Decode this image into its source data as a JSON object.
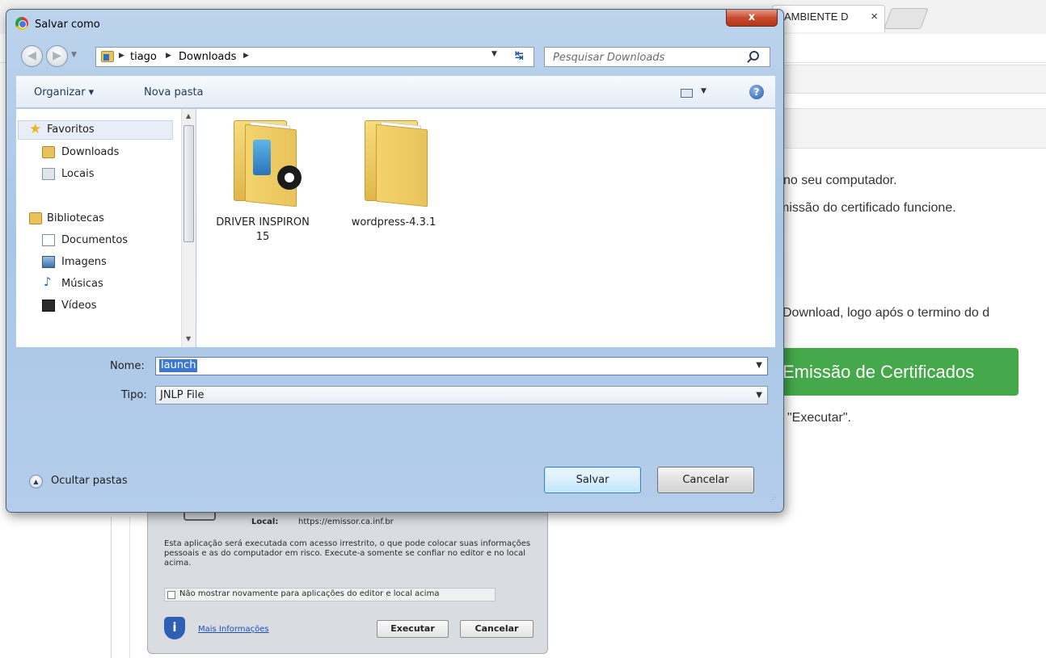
{
  "browser": {
    "tab_title": "AMBIENTE D",
    "tab_close": "×"
  },
  "page": {
    "line1": "no seu computador.",
    "line2": "missão do certificado funcione.",
    "line3": "Download, logo após o termino do d",
    "emission_button": "Emissão de Certificados",
    "line4": "\"Executar\".",
    "accent_color": "#45a84a"
  },
  "java_dialog": {
    "local_label": "Local:",
    "local_value": "https://emissor.ca.inf.br",
    "warning": "Esta aplicação será executada com acesso irrestrito, o que pode colocar suas informações pessoais e as do computador em risco. Execute-a somente se confiar no editor e no local acima.",
    "checkbox_label": "Não mostrar novamente para aplicações do editor e local acima",
    "more_info": "Mais Informações",
    "run_button": "Executar",
    "cancel_button": "Cancelar",
    "info_icon": "i"
  },
  "save_dialog": {
    "title": "Salvar como",
    "close_glyph": "x",
    "breadcrumbs": [
      "tiago",
      "Downloads"
    ],
    "search_placeholder": "Pesquisar Downloads",
    "toolbar": {
      "organize": "Organizar ▾",
      "new_folder": "Nova pasta",
      "help": "?"
    },
    "nav": {
      "favorites": "Favoritos",
      "downloads": "Downloads",
      "places": "Locais",
      "libraries": "Bibliotecas",
      "documents": "Documentos",
      "images": "Imagens",
      "music": "Músicas",
      "videos": "Vídeos"
    },
    "files": [
      {
        "name": "DRIVER INSPIRON 15"
      },
      {
        "name": "wordpress-4.3.1"
      }
    ],
    "filename_label": "Nome:",
    "filename_value": "launch",
    "type_label": "Tipo:",
    "type_value": "JNLP File",
    "hide_folders": "Ocultar pastas",
    "save_button": "Salvar",
    "cancel_button": "Cancelar"
  }
}
